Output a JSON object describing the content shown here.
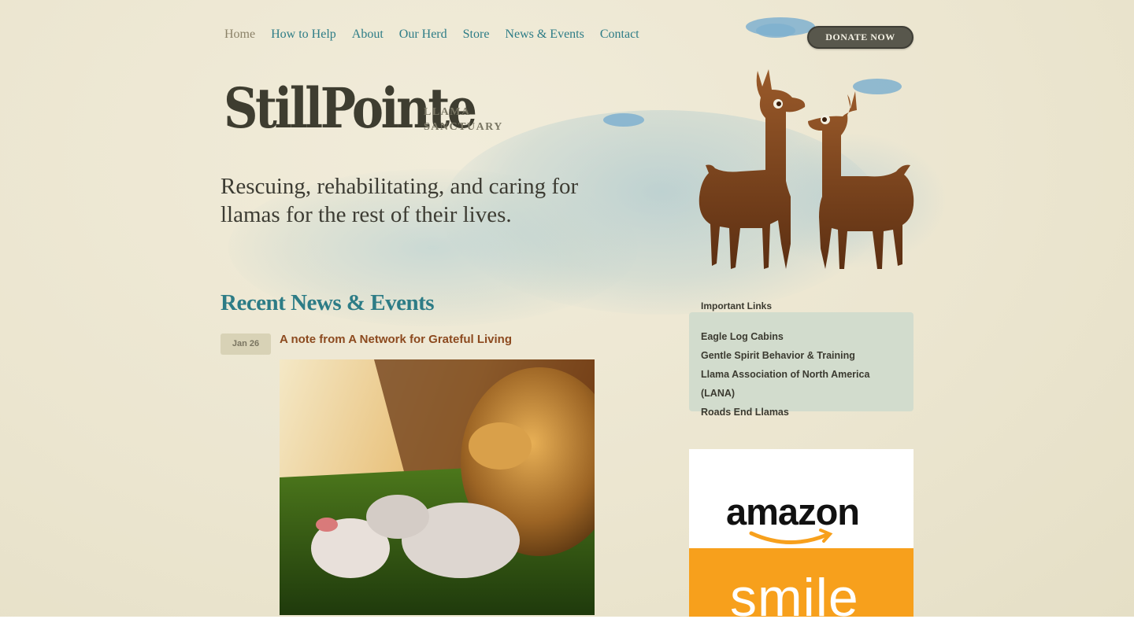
{
  "nav": {
    "items": [
      {
        "label": "Home",
        "active": true
      },
      {
        "label": "How to Help",
        "active": false
      },
      {
        "label": "About",
        "active": false
      },
      {
        "label": "Our Herd",
        "active": false
      },
      {
        "label": "Store",
        "active": false
      },
      {
        "label": "News & Events",
        "active": false
      },
      {
        "label": "Contact",
        "active": false
      }
    ],
    "donate_label": "DONATE NOW"
  },
  "logo": {
    "name": "StillPointe",
    "sub_line1": "LLAMA",
    "sub_line2": "SANCTUARY"
  },
  "hero": {
    "tagline": "Rescuing, rehabilitating, and caring for llamas for the rest of their lives."
  },
  "news": {
    "heading": "Recent News & Events",
    "posts": [
      {
        "date": "Jan 26",
        "title": "A note from A Network for Grateful Living"
      }
    ]
  },
  "sidebar": {
    "links_title": "Important Links",
    "links": [
      "Eagle Log Cabins",
      "Gentle Spirit Behavior & Training",
      "Llama Association of North America (LANA)",
      "Roads End Llamas"
    ],
    "amazon": {
      "word": "amazon",
      "smile": "smile"
    }
  },
  "colors": {
    "background": "#ece7d4",
    "nav_link": "#2d7c86",
    "nav_active": "#8b8268",
    "heading": "#2d7c86",
    "post_title": "#8c4a1f",
    "links_box": "#d2dccd",
    "donate_button": "#58574c",
    "llama": "#6e3a17",
    "amazon_orange": "#f7a01c"
  },
  "icons": [
    "llama-illustration",
    "amazon-smile-arrow",
    "cloud-decoration"
  ]
}
